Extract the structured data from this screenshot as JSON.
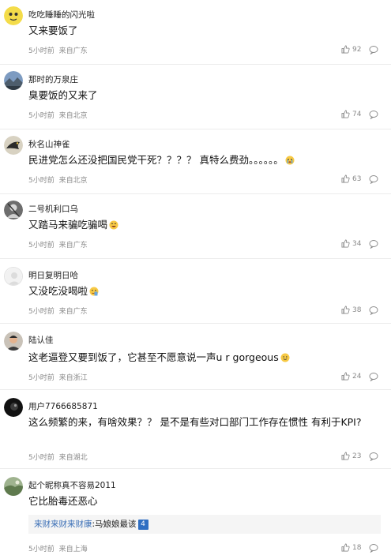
{
  "comments": [
    {
      "username": "吃吃睡睡的闪光啦",
      "text": "又来要饭了",
      "time": "5小时前",
      "location": "来自广东",
      "likes": "92",
      "avatar_icon": "yellow-character-avatar"
    },
    {
      "username": "那时的万泉庄",
      "text": "臭要饭的又来了",
      "time": "5小时前",
      "location": "来自北京",
      "likes": "74",
      "avatar_icon": "landscape-avatar"
    },
    {
      "username": "秋名山神雀",
      "text": "民进党怎么还没把国民党干死？？？？ 真特么费劲。。。。。。",
      "time": "5小时前",
      "location": "来自北京",
      "likes": "63",
      "emoji": "crying-face-emoji",
      "avatar_icon": "dark-bird-avatar"
    },
    {
      "username": "二号机利口乌",
      "text": "又踏马来骗吃骗喝",
      "time": "5小时前",
      "location": "来自广东",
      "likes": "34",
      "emoji": "grinning-face-emoji",
      "avatar_icon": "gray-figure-avatar"
    },
    {
      "username": "明日复明日哈",
      "text": "又没吃没喝啦",
      "time": "5小时前",
      "location": "来自广东",
      "likes": "38",
      "emoji": "drinking-face-emoji",
      "avatar_icon": "default-avatar"
    },
    {
      "username": "陆认佳",
      "text": "这老逼登又要到饭了，它甚至不愿意说一声u r gorgeous",
      "time": "5小时前",
      "location": "来自浙江",
      "likes": "24",
      "emoji": "smiling-face-emoji",
      "avatar_icon": "person-avatar"
    },
    {
      "username": "用户7766685871",
      "text": "这么频繁的来，有啥效果？？ 是不是有些对口部门工作存在惯性 有利于KPI?",
      "time": "5小时前",
      "location": "来自湖北",
      "likes": "23",
      "avatar_icon": "dark-orb-avatar"
    },
    {
      "username": "起个昵称真不容易2011",
      "text": "它比胎毒还恶心",
      "time": "5小时前",
      "location": "来自上海",
      "likes": "18",
      "avatar_icon": "green-scene-avatar",
      "subreply": {
        "name": "来财来财来财康",
        "text": ":马娘娘最该",
        "badge": "4"
      }
    }
  ],
  "colors": {
    "link": "#3b6fb6",
    "meta": "#8a8a8a",
    "divider": "#ececec",
    "badge": "#2f6ec2"
  },
  "icons": {
    "like": "thumbs-up-icon",
    "reply": "comment-bubble-icon"
  }
}
